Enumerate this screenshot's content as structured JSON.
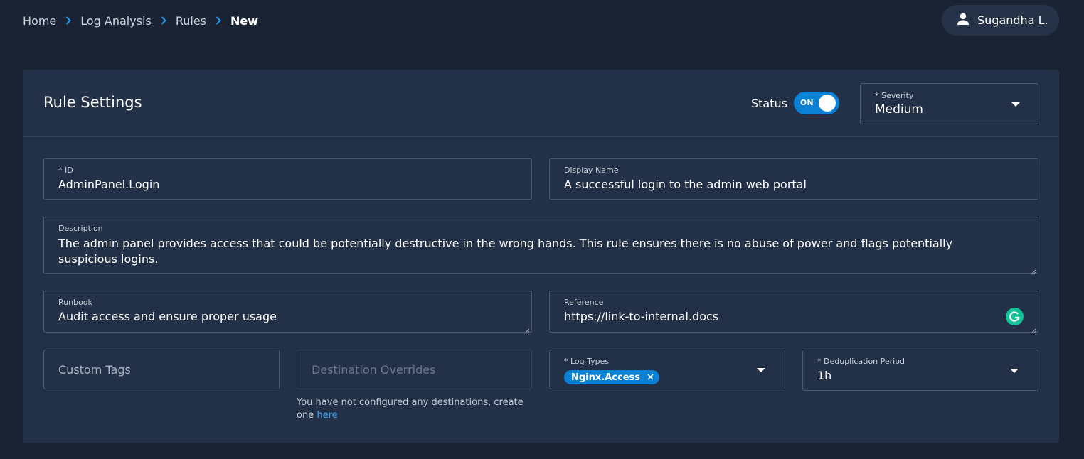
{
  "breadcrumb": {
    "items": [
      "Home",
      "Log Analysis",
      "Rules"
    ],
    "current": "New"
  },
  "user": {
    "name": "Sugandha L.",
    "icon": "user-icon"
  },
  "panel": {
    "title": "Rule Settings",
    "status_label": "Status",
    "status_toggle": "ON",
    "severity": {
      "label": "* Severity",
      "value": "Medium"
    }
  },
  "form": {
    "id": {
      "label": "* ID",
      "value": "AdminPanel.Login"
    },
    "display_name": {
      "label": "Display Name",
      "value": "A successful login to the admin web portal"
    },
    "description": {
      "label": "Description",
      "value": "The admin panel provides access that could be potentially destructive in the wrong hands. This rule ensures there is no abuse of power and flags potentially suspicious logins."
    },
    "runbook": {
      "label": "Runbook",
      "value": "Audit access and ensure proper usage"
    },
    "reference": {
      "label": "Reference",
      "value": "https://link-to-internal.docs"
    },
    "custom_tags": {
      "placeholder": "Custom Tags"
    },
    "destination_overrides": {
      "placeholder": "Destination Overrides",
      "hint": "You have not configured any destinations, create one",
      "hint_link": "here"
    },
    "log_types": {
      "label": "* Log Types",
      "tags": [
        "Nginx.Access"
      ]
    },
    "dedup_period": {
      "label": "* Deduplication Period",
      "value": "1h"
    }
  },
  "colors": {
    "accent": "#0b81d6",
    "background": "#1a2333",
    "panel": "#233148",
    "grammarly": "#15c39a"
  }
}
